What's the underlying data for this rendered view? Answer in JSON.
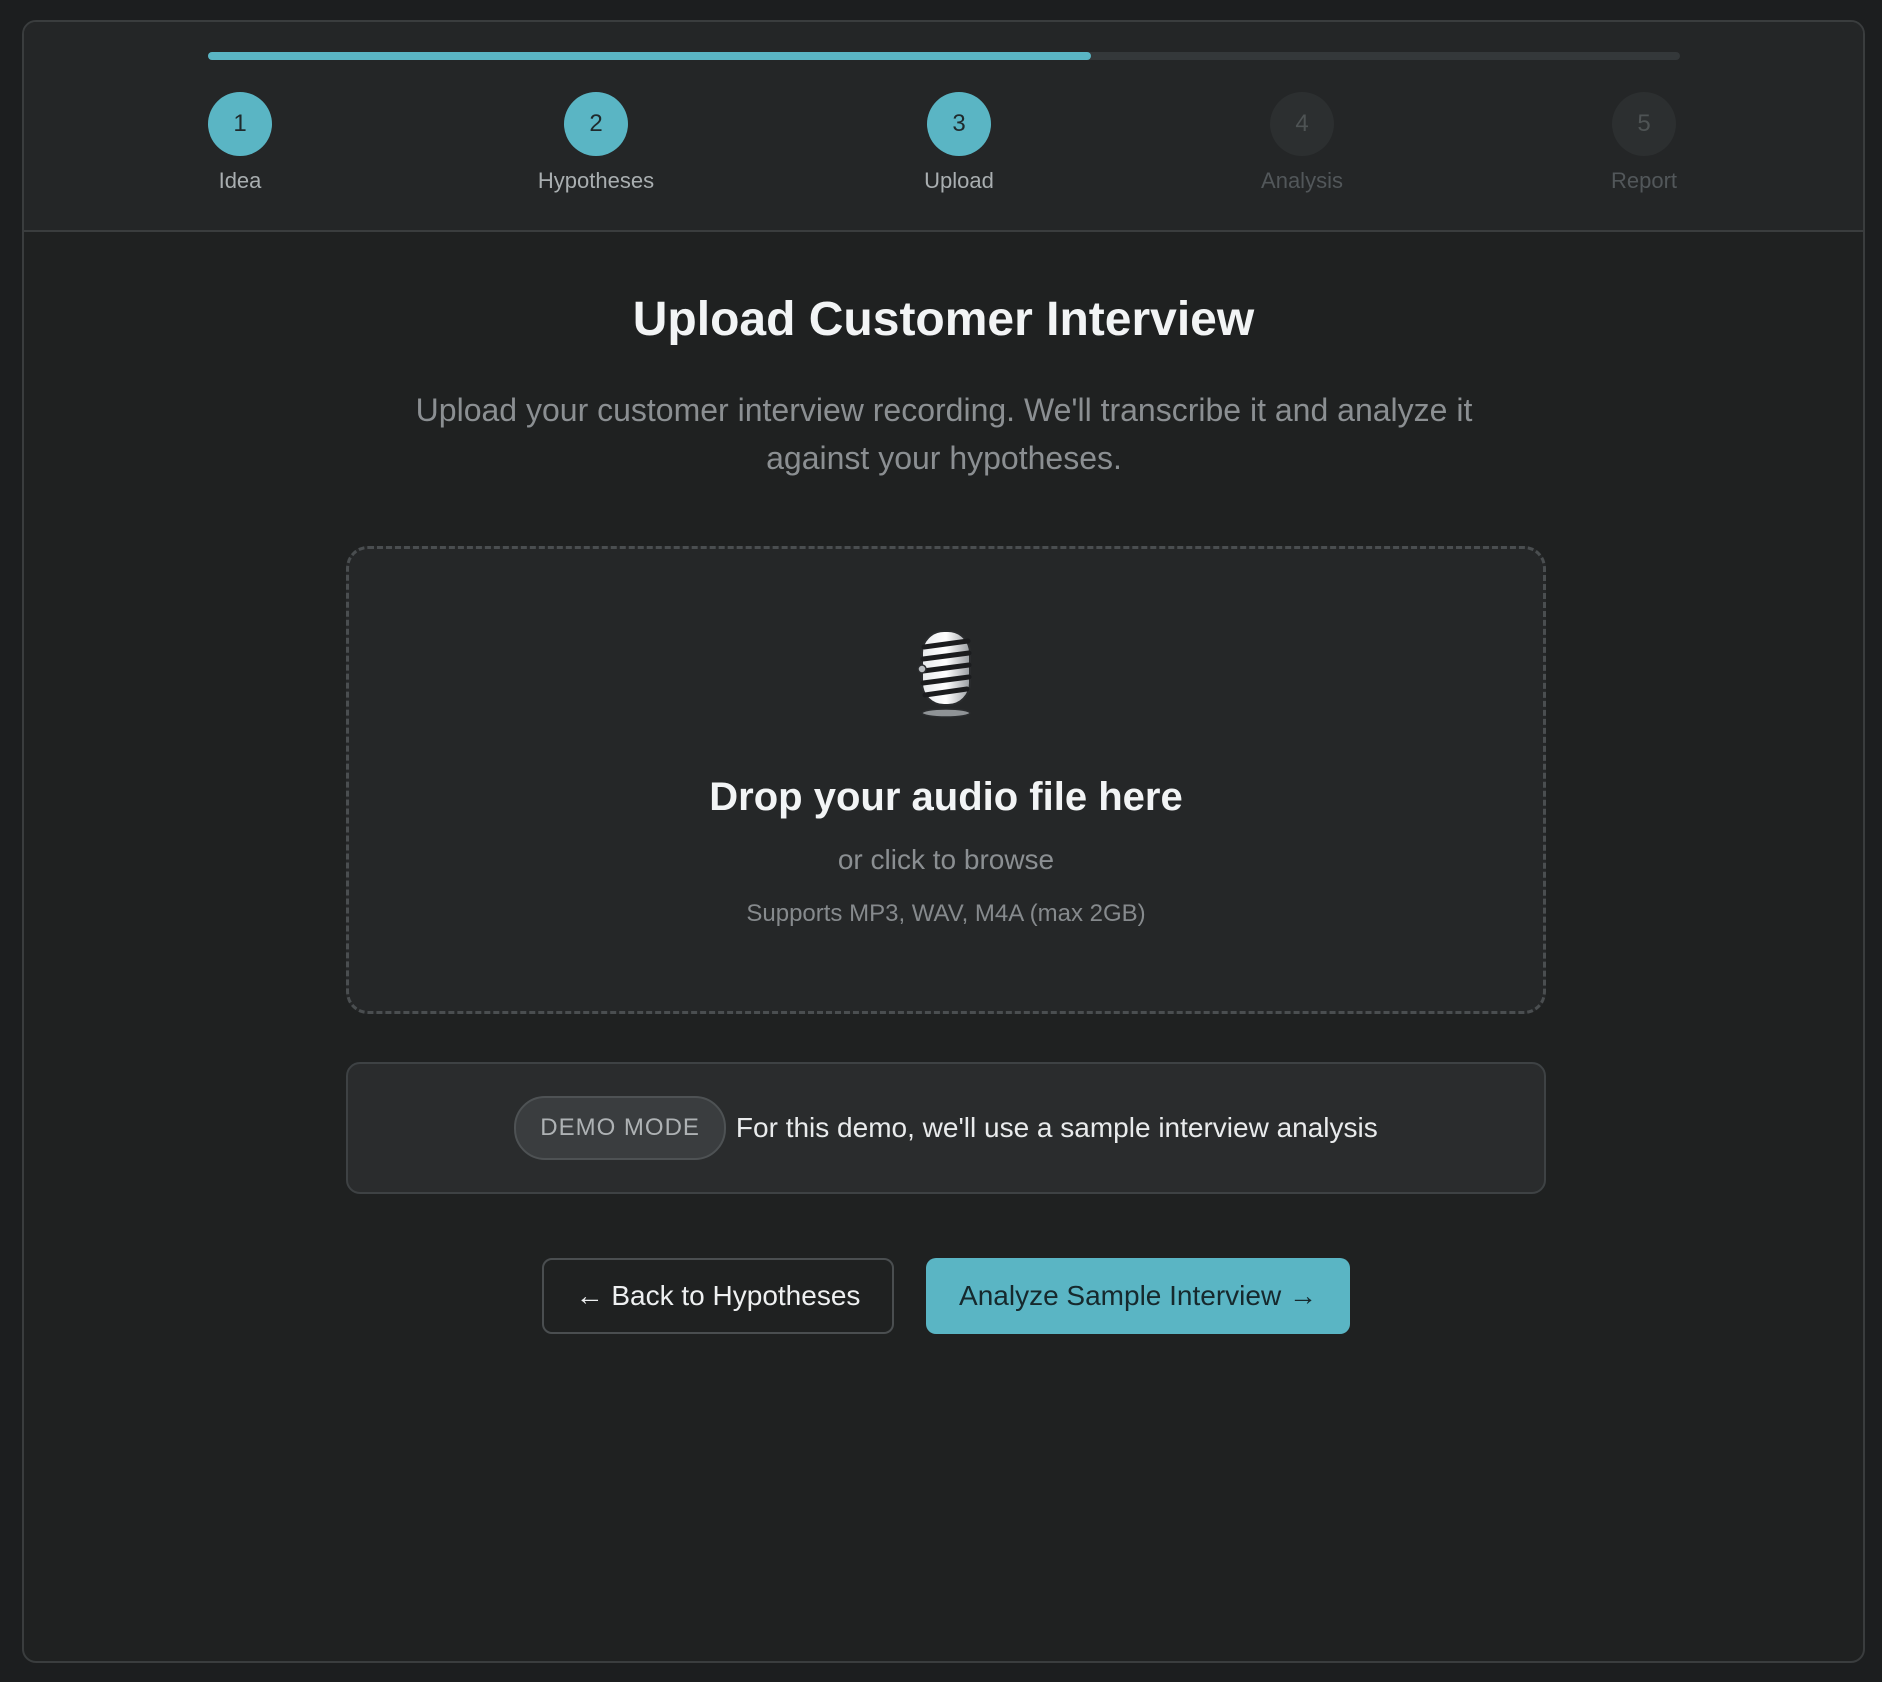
{
  "progress": {
    "fraction": 0.6
  },
  "steps": [
    {
      "number": "1",
      "label": "Idea",
      "state": "done"
    },
    {
      "number": "2",
      "label": "Hypotheses",
      "state": "done"
    },
    {
      "number": "3",
      "label": "Upload",
      "state": "done"
    },
    {
      "number": "4",
      "label": "Analysis",
      "state": "todo"
    },
    {
      "number": "5",
      "label": "Report",
      "state": "todo"
    }
  ],
  "main": {
    "title": "Upload Customer Interview",
    "subtitle": "Upload your customer interview recording. We'll transcribe it and analyze it against your hypotheses."
  },
  "dropzone": {
    "icon": "microphone-icon",
    "title": "Drop your audio file here",
    "subtitle": "or click to browse",
    "formats": "Supports MP3, WAV, M4A (max 2GB)"
  },
  "demo": {
    "badge": "DEMO MODE",
    "text": "For this demo, we'll use a sample interview analysis"
  },
  "actions": {
    "back_label": "← Back to Hypotheses",
    "next_label": "Analyze Sample Interview →"
  },
  "colors": {
    "accent": "#5ab5c4",
    "background": "#1f2121"
  }
}
